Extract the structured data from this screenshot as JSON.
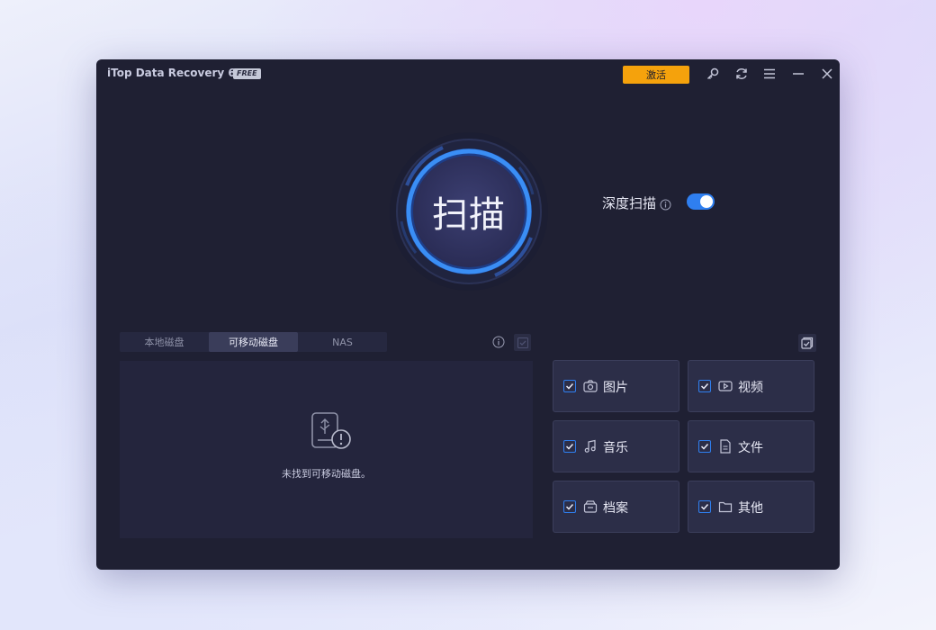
{
  "app": {
    "title": "iTop Data Recovery 6.0",
    "edition_badge": "FREE"
  },
  "toolbar": {
    "activate_label": "激活"
  },
  "scan": {
    "button_label": "扫描",
    "deep_scan_label": "深度扫描",
    "deep_scan_enabled": true
  },
  "drive_tabs": [
    {
      "label": "本地磁盘",
      "active": false
    },
    {
      "label": "可移动磁盘",
      "active": true
    },
    {
      "label": "NAS",
      "active": false
    }
  ],
  "drive_panel": {
    "empty_message": "未找到可移动磁盘。"
  },
  "categories": [
    {
      "label": "图片",
      "icon": "camera-icon",
      "checked": true
    },
    {
      "label": "视频",
      "icon": "video-icon",
      "checked": true
    },
    {
      "label": "音乐",
      "icon": "music-icon",
      "checked": true
    },
    {
      "label": "文件",
      "icon": "document-icon",
      "checked": true
    },
    {
      "label": "档案",
      "icon": "archive-icon",
      "checked": true
    },
    {
      "label": "其他",
      "icon": "folder-icon",
      "checked": true
    }
  ],
  "colors": {
    "accent": "#2f7ff0",
    "activate": "#f5a20c",
    "window_bg": "#1f2033"
  }
}
